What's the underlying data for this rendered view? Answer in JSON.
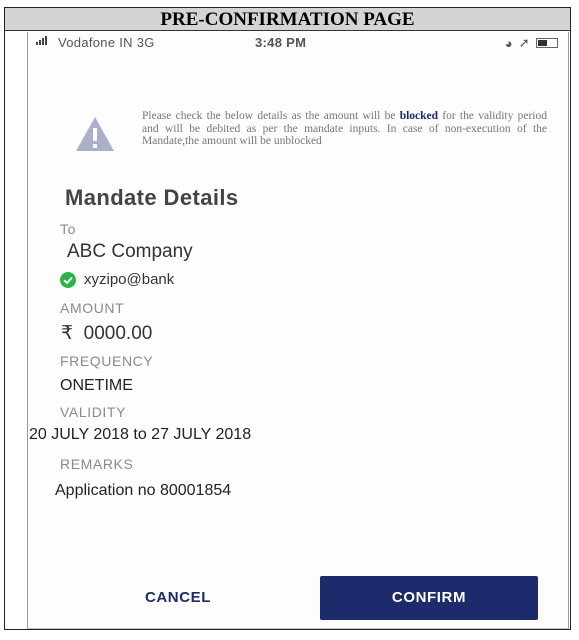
{
  "page": {
    "header_title": "PRE-CONFIRMATION PAGE"
  },
  "status_bar": {
    "carrier": "Vodafone IN  3G",
    "time": "3:48 PM"
  },
  "notice": {
    "before": "Please check the below details as the amount will be ",
    "bold": "blocked",
    "after": " for the validity period and will be debited as per the mandate inputs. In case of non-execution of the Mandate,the amount will be unblocked"
  },
  "mandate": {
    "title": "Mandate Details",
    "to_label": "To",
    "payee_name": "ABC Company",
    "vpa": "xyzipo@bank",
    "amount_label": "AMOUNT",
    "currency_symbol": "₹",
    "amount": "0000.00",
    "frequency_label": "FREQUENCY",
    "frequency": "ONETIME",
    "validity_label": "VALIDITY",
    "validity": "20 JULY 2018 to 27 JULY 2018",
    "remarks_label": "REMARKS",
    "remarks": "Application no 80001854"
  },
  "actions": {
    "cancel_label": "CANCEL",
    "confirm_label": "CONFIRM"
  },
  "colors": {
    "accent": "#1d2a6b",
    "success": "#2bb34a",
    "warning_icon": "#a8b0cc"
  },
  "icons": [
    "warning-triangle-icon",
    "verified-check-icon",
    "signal-bars-icon",
    "battery-icon"
  ]
}
